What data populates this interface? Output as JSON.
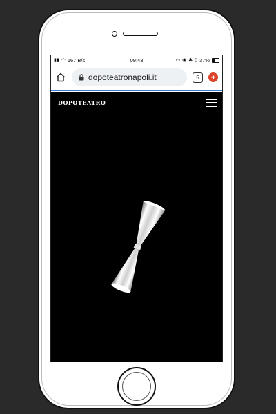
{
  "status_bar": {
    "speed": "167 B/s",
    "time": "09:43",
    "battery": "37%"
  },
  "browser": {
    "url": "dopoteatronapoli.it",
    "tab_count": "5",
    "icons": [
      "home-icon",
      "lock-icon",
      "tabs-icon",
      "update-icon"
    ]
  },
  "site": {
    "logo": "DOPOTEATRO",
    "menu_icon": "hamburger-menu-icon",
    "hero_image": "cocktail-jigger"
  },
  "colors": {
    "background": "#2a2a2a",
    "site_background": "#000000",
    "accent": "#3a7bd5",
    "update_badge": "#d9442a"
  }
}
